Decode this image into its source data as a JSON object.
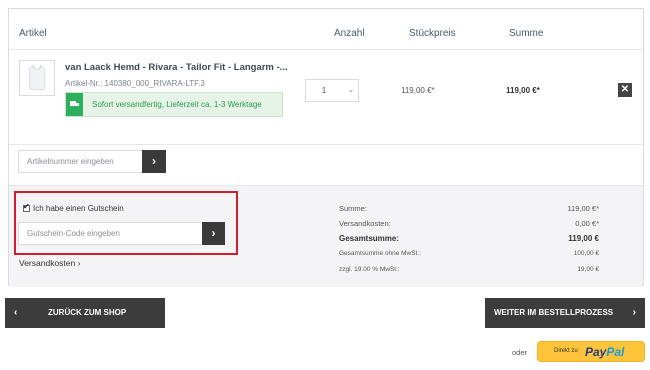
{
  "table_header": {
    "article": "Artikel",
    "quantity": "Anzahl",
    "unit_price": "Stückpreis",
    "sum": "Summe"
  },
  "item": {
    "name": "van Laack Hemd - Rivara - Tailor Fit - Langarm -...",
    "article_number": "Artikel-Nr.: 140380_000_RIVARA-LTF.3",
    "delivery": "Sofort versandfertig, Lieferzeit ca. 1-3 Werktage",
    "quantity": "1",
    "unit_price": "119,00 €*",
    "total": "119,00 €*",
    "remove_icon": "close-icon"
  },
  "add_article": {
    "placeholder": "Artikelnummer eingeben",
    "button_icon": "chevron-right-icon"
  },
  "voucher": {
    "checkbox_label": "Ich habe einen Gutschein",
    "checked": true,
    "placeholder": "Gutschein-Code eingeben",
    "button_icon": "chevron-right-icon"
  },
  "shipping_link": "Versandkosten ›",
  "summary": {
    "rows": [
      {
        "label": "Summe:",
        "value": "119,00 €*"
      },
      {
        "label": "Versandkosten:",
        "value": "0,00 €*"
      },
      {
        "label": "Gesamtsumme:",
        "value": "119,00 €"
      },
      {
        "label": "Gesamtsumme ohne MwSt.:",
        "value": "100,00 €"
      },
      {
        "label": "zzgl. 19.00 % MwSt.:",
        "value": "19,00 €"
      }
    ]
  },
  "nav": {
    "back_label": "ZURÜCK ZUM SHOP",
    "back_arrow": "‹",
    "next_label": "WEITER IM BESTELLPROZESS",
    "next_arrow": "›"
  },
  "paypal": {
    "or_label": "oder",
    "small_label": "Direkt zu",
    "brand_pay": "Pay",
    "brand_pal": "Pal"
  },
  "colors": {
    "highlight_border": "#d0202f",
    "button_dark": "#3c3c3c",
    "delivery_green": "#2eaf5e",
    "paypal_yellow": "#ffc439"
  }
}
